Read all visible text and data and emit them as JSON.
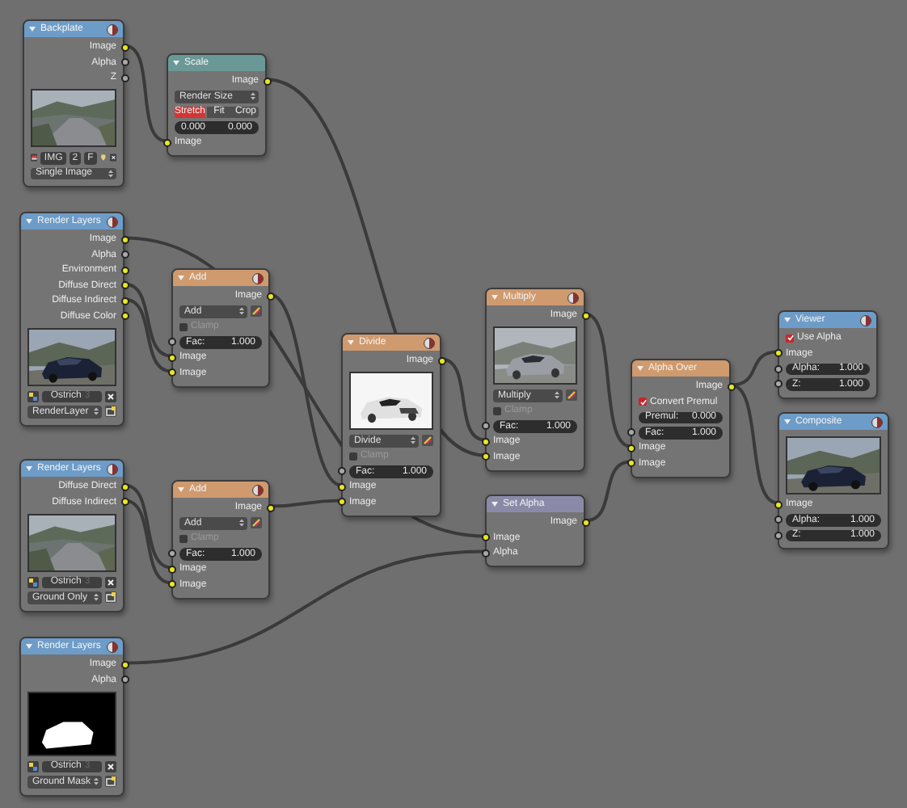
{
  "nodes": [
    {
      "title": "Backplate",
      "kind": "input",
      "render_icon": true,
      "rows": [
        {
          "kind": "output",
          "label": "Image",
          "color": "#e8e820"
        },
        {
          "kind": "output",
          "label": "Alpha",
          "color": "#a8a8a8"
        },
        {
          "kind": "output",
          "label": "Z",
          "color": "#a8a8a8"
        },
        {
          "kind": "picture"
        },
        {
          "kind": "image_select",
          "name": "IMG",
          "users": "2",
          "flag": "F"
        },
        {
          "kind": "dropdown",
          "value": "Single Image",
          "icon_button": false
        }
      ]
    },
    {
      "title": "Scale",
      "kind": "distort",
      "render_icon": false,
      "rows": [
        {
          "kind": "output",
          "label": "Image",
          "color": "#e8e820"
        },
        {
          "kind": "dropdown",
          "value": "Render Size",
          "icon_button": false
        },
        {
          "kind": "options",
          "options": [
            {
              "label": "Stretch",
              "selected": true
            },
            {
              "label": "Fit",
              "selected": false
            },
            {
              "label": "Crop",
              "selected": false
            }
          ]
        },
        {
          "kind": "pair",
          "values": [
            "0.000",
            "0.000"
          ]
        },
        {
          "kind": "input",
          "label": "Image",
          "color": "#e8e820"
        }
      ]
    },
    {
      "title": "Render Layers",
      "kind": "input",
      "render_icon": true,
      "rows": [
        {
          "kind": "output",
          "label": "Image",
          "color": "#e8e820"
        },
        {
          "kind": "output",
          "label": "Alpha",
          "color": "#a8a8a8"
        },
        {
          "kind": "output",
          "label": "Environment",
          "color": "#e8e820"
        },
        {
          "kind": "output",
          "label": "Diffuse Direct",
          "color": "#e8e820"
        },
        {
          "kind": "output",
          "label": "Diffuse Indirect",
          "color": "#e8e820"
        },
        {
          "kind": "output",
          "label": "Diffuse Color",
          "color": "#e8e820"
        },
        {
          "kind": "picture"
        },
        {
          "kind": "scene",
          "name": "Ostrich",
          "users": "3"
        },
        {
          "kind": "dropdown",
          "value": "RenderLayer",
          "icon_button": true
        }
      ]
    },
    {
      "title": "Add",
      "kind": "color",
      "render_icon": true,
      "rows": [
        {
          "kind": "output",
          "label": "Image",
          "color": "#e8e820"
        },
        {
          "kind": "dropdown",
          "value": "Add",
          "icon_button": true
        },
        {
          "kind": "checkbox",
          "label": "Clamp",
          "checked": false
        },
        {
          "kind": "field",
          "label": "Fac:",
          "value": "1.000",
          "color": "#a8a8a8"
        },
        {
          "kind": "input",
          "label": "Image",
          "color": "#e8e820"
        },
        {
          "kind": "input",
          "label": "Image",
          "color": "#e8e820"
        }
      ]
    },
    {
      "title": "Divide",
      "kind": "color",
      "render_icon": true,
      "rows": [
        {
          "kind": "output",
          "label": "Image",
          "color": "#e8e820"
        },
        {
          "kind": "picture"
        },
        {
          "kind": "dropdown",
          "value": "Divide",
          "icon_button": true
        },
        {
          "kind": "checkbox",
          "label": "Clamp",
          "checked": false
        },
        {
          "kind": "field",
          "label": "Fac:",
          "value": "1.000",
          "color": "#a8a8a8"
        },
        {
          "kind": "input",
          "label": "Image",
          "color": "#e8e820"
        },
        {
          "kind": "input",
          "label": "Image",
          "color": "#e8e820"
        }
      ]
    },
    {
      "title": "Multiply",
      "kind": "color",
      "render_icon": true,
      "rows": [
        {
          "kind": "output",
          "label": "Image",
          "color": "#e8e820"
        },
        {
          "kind": "picture"
        },
        {
          "kind": "dropdown",
          "value": "Multiply",
          "icon_button": true
        },
        {
          "kind": "checkbox",
          "label": "Clamp",
          "checked": false
        },
        {
          "kind": "field",
          "label": "Fac:",
          "value": "1.000",
          "color": "#a8a8a8"
        },
        {
          "kind": "input",
          "label": "Image",
          "color": "#e8e820"
        },
        {
          "kind": "input",
          "label": "Image",
          "color": "#e8e820"
        }
      ]
    },
    {
      "title": "Alpha Over",
      "kind": "color",
      "render_icon": false,
      "rows": [
        {
          "kind": "output",
          "label": "Image",
          "color": "#e8e820"
        },
        {
          "kind": "checkbox",
          "label": "Convert Premul",
          "checked": true
        },
        {
          "kind": "field",
          "label": "Premul:",
          "value": "0.000"
        },
        {
          "kind": "field",
          "label": "Fac:",
          "value": "1.000",
          "color": "#a8a8a8"
        },
        {
          "kind": "input",
          "label": "Image",
          "color": "#e8e820"
        },
        {
          "kind": "input",
          "label": "Image",
          "color": "#e8e820"
        }
      ]
    },
    {
      "title": "Viewer",
      "kind": "output",
      "render_icon": true,
      "rows": [
        {
          "kind": "checkbox",
          "label": "Use Alpha",
          "checked": true
        },
        {
          "kind": "input",
          "label": "Image",
          "color": "#e8e820"
        },
        {
          "kind": "field",
          "label": "Alpha:",
          "value": "1.000",
          "color": "#a8a8a8"
        },
        {
          "kind": "field",
          "label": "Z:",
          "value": "1.000",
          "color": "#a8a8a8"
        }
      ]
    },
    {
      "title": "Composite",
      "kind": "output",
      "render_icon": true,
      "rows": [
        {
          "kind": "picture"
        },
        {
          "kind": "input",
          "label": "Image",
          "color": "#e8e820"
        },
        {
          "kind": "field",
          "label": "Alpha:",
          "value": "1.000",
          "color": "#a8a8a8"
        },
        {
          "kind": "field",
          "label": "Z:",
          "value": "1.000",
          "color": "#a8a8a8"
        }
      ]
    },
    {
      "title": "Render Layers",
      "kind": "input",
      "render_icon": true,
      "rows": [
        {
          "kind": "output",
          "label": "Diffuse Direct",
          "color": "#e8e820"
        },
        {
          "kind": "output",
          "label": "Diffuse Indirect",
          "color": "#e8e820"
        },
        {
          "kind": "picture"
        },
        {
          "kind": "scene",
          "name": "Ostrich",
          "users": "3"
        },
        {
          "kind": "dropdown",
          "value": "Ground Only",
          "icon_button": true
        }
      ]
    },
    {
      "title": "Add",
      "kind": "color",
      "render_icon": true,
      "rows": [
        {
          "kind": "output",
          "label": "Image",
          "color": "#e8e820"
        },
        {
          "kind": "dropdown",
          "value": "Add",
          "icon_button": true
        },
        {
          "kind": "checkbox",
          "label": "Clamp",
          "checked": false
        },
        {
          "kind": "field",
          "label": "Fac:",
          "value": "1.000",
          "color": "#a8a8a8"
        },
        {
          "kind": "input",
          "label": "Image",
          "color": "#e8e820"
        },
        {
          "kind": "input",
          "label": "Image",
          "color": "#e8e820"
        }
      ]
    },
    {
      "title": "Set Alpha",
      "kind": "converter",
      "render_icon": false,
      "rows": [
        {
          "kind": "output",
          "label": "Image",
          "color": "#e8e820"
        },
        {
          "kind": "input",
          "label": "Image",
          "color": "#e8e820"
        },
        {
          "kind": "input",
          "label": "Alpha",
          "color": "#a8a8a8"
        }
      ]
    },
    {
      "title": "Render Layers",
      "kind": "input",
      "render_icon": true,
      "rows": [
        {
          "kind": "output",
          "label": "Image",
          "color": "#e8e820"
        },
        {
          "kind": "output",
          "label": "Alpha",
          "color": "#a8a8a8"
        },
        {
          "kind": "picture"
        },
        {
          "kind": "scene",
          "name": "Ostrich",
          "users": "3"
        },
        {
          "kind": "dropdown",
          "value": "Ground Mask",
          "icon_button": true
        }
      ]
    }
  ]
}
